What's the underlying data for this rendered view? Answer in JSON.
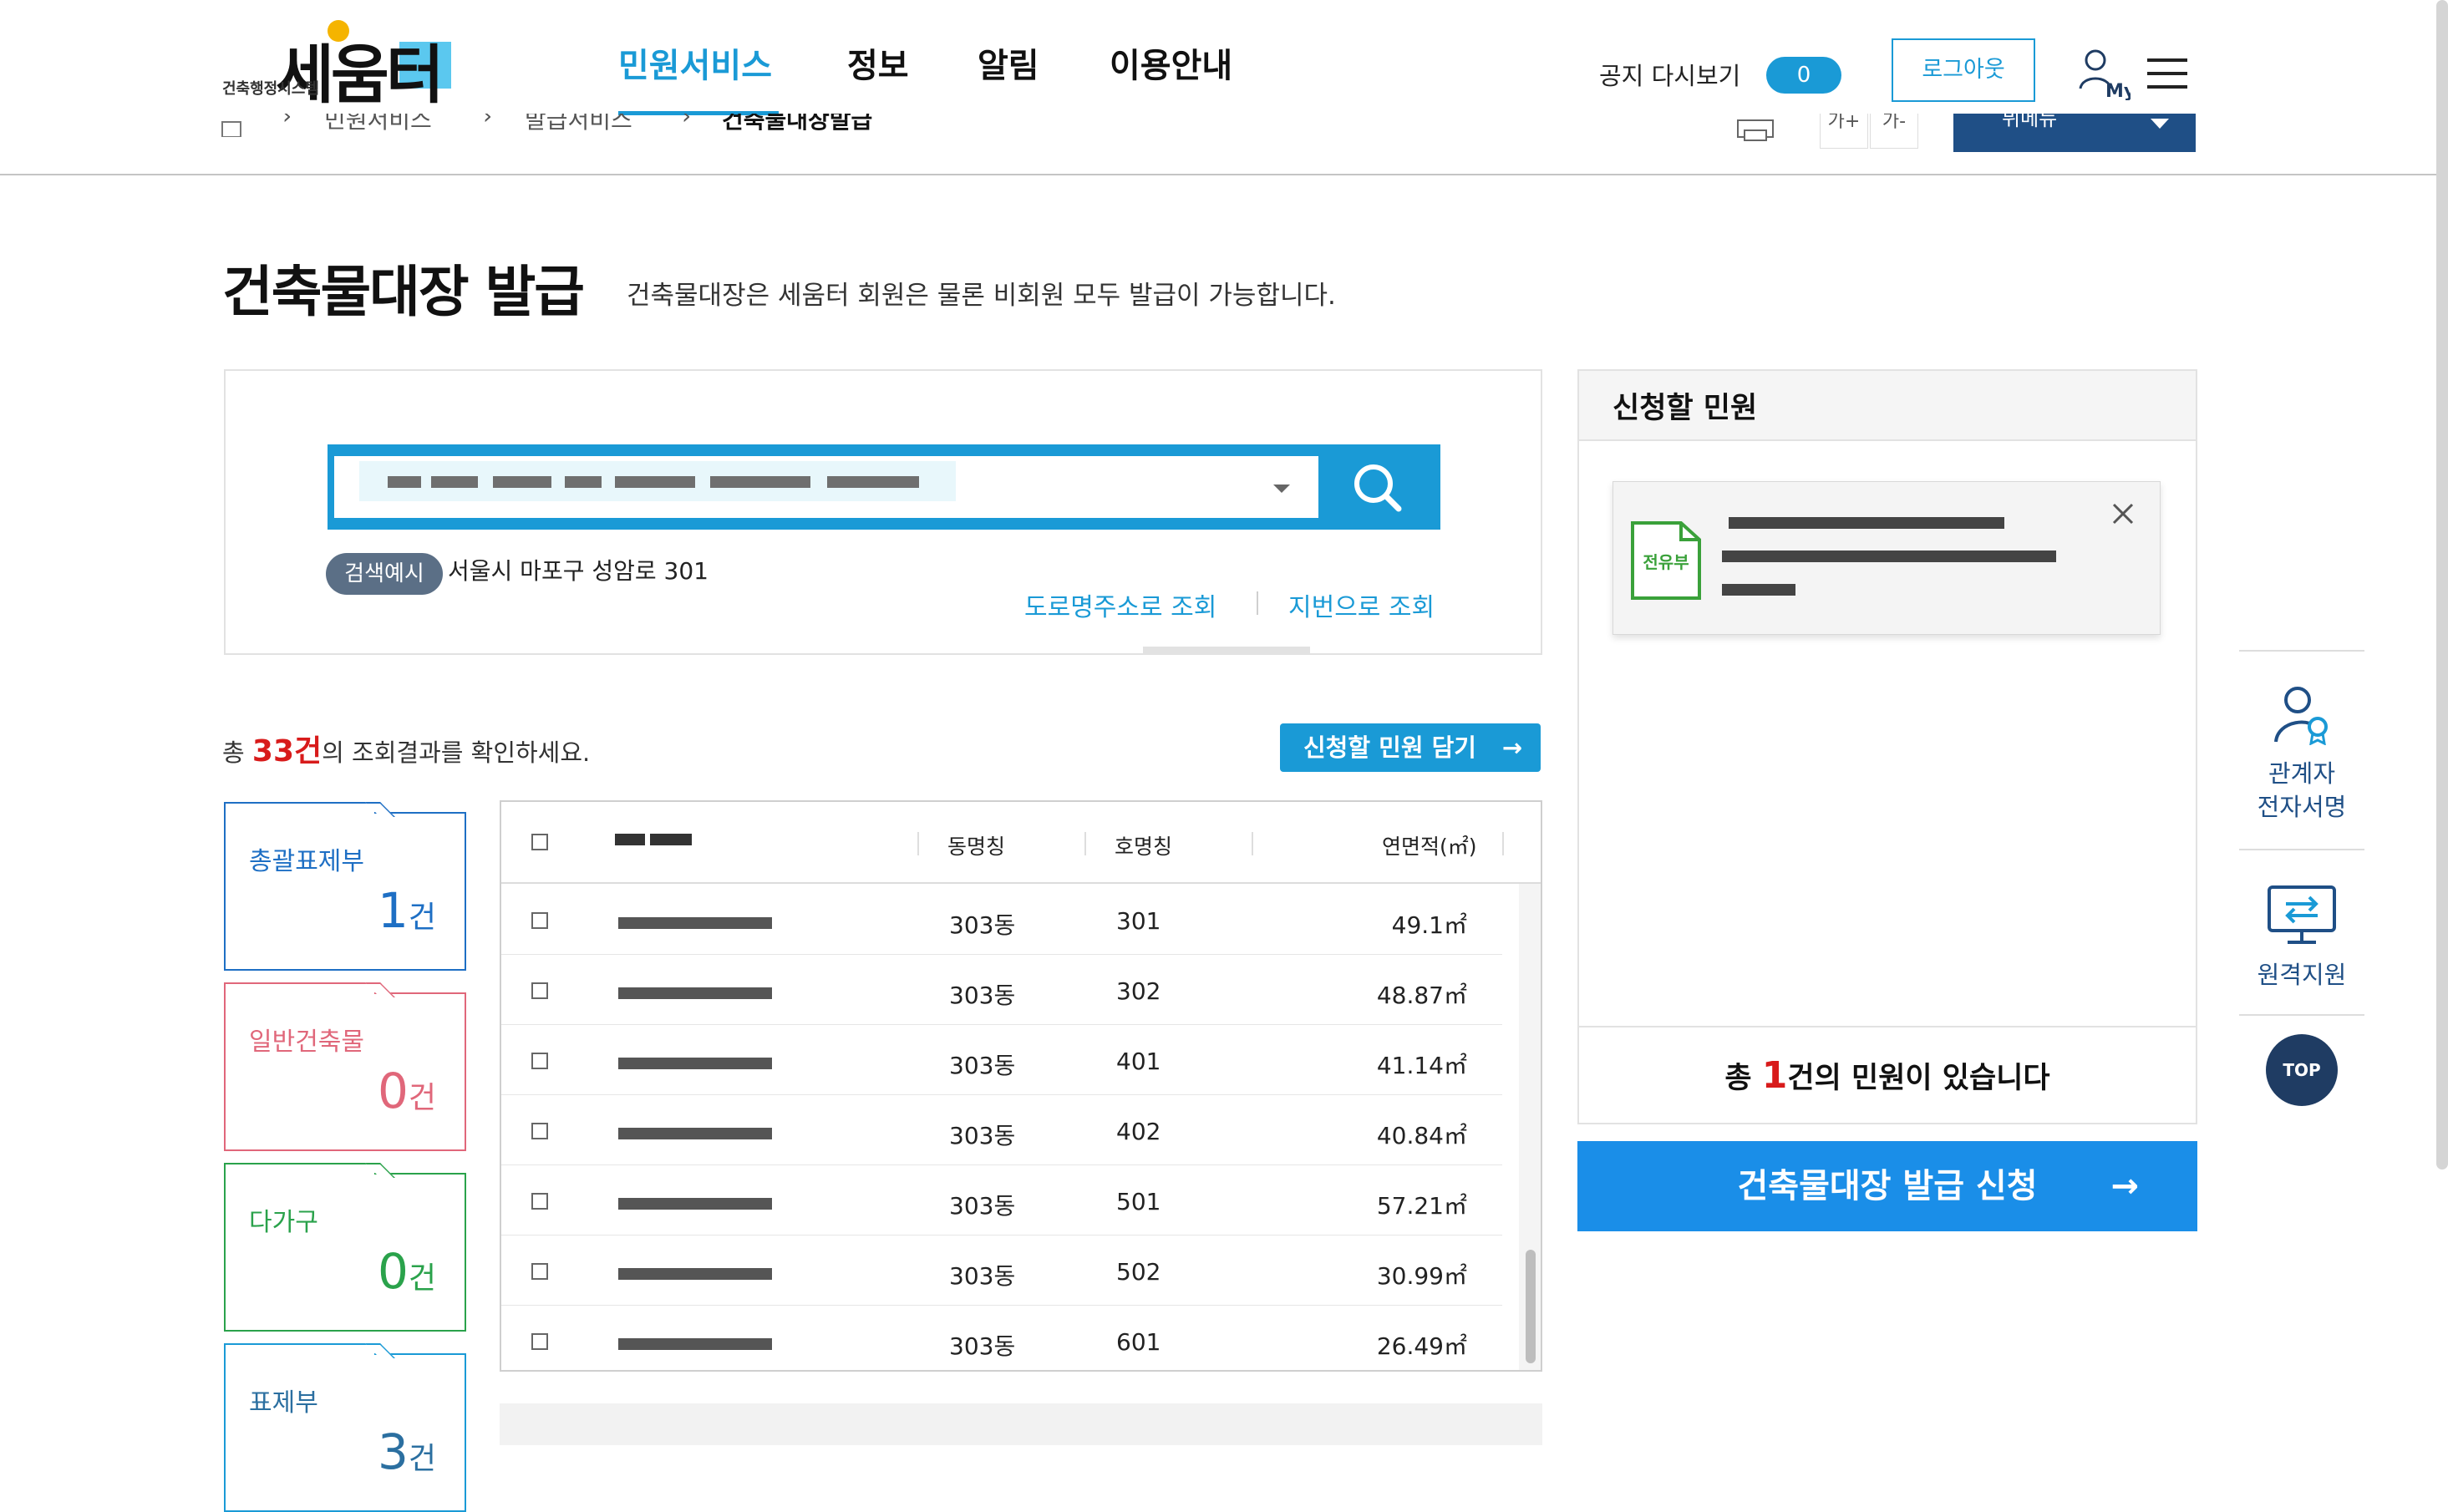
{
  "header": {
    "logo": {
      "text": "세움터",
      "sub": "건축행정시스템"
    },
    "nav": [
      "민원서비스",
      "정보",
      "알림",
      "이용안내"
    ],
    "notice_label": "공지 다시보기",
    "notice_count": "0",
    "logout_label": "로그아웃",
    "my_label": "My",
    "breadcrumb": [
      "민원서비스",
      "발급서비스",
      "건축물대장발급"
    ],
    "font_up": "가+",
    "font_down": "가-",
    "site_menu": "뷔메뉴"
  },
  "page": {
    "title": "건축물대장 발급",
    "description": "건축물대장은 세움터 회원은 물론 비회원 모두 발급이 가능합니다."
  },
  "search": {
    "example_badge": "검색예시",
    "example_text": "서울시 마포구 성암로 301",
    "road_label": "도로명주소로 조회",
    "jibun_label": "지번으로 조회"
  },
  "results": {
    "prefix": "총 ",
    "count": "33건",
    "suffix": "의 조회결과를 확인하세요.",
    "add_label": "신청할 민원 담기",
    "arrow": "→"
  },
  "categories": [
    {
      "label": "총괄표제부",
      "count": "1",
      "unit": "건"
    },
    {
      "label": "일반건축물",
      "count": "0",
      "unit": "건"
    },
    {
      "label": "다가구",
      "count": "0",
      "unit": "건"
    },
    {
      "label": "표제부",
      "count": "3",
      "unit": "건"
    }
  ],
  "table": {
    "columns": [
      "동명칭",
      "호명칭",
      "연면적(㎡)"
    ],
    "rows": [
      {
        "dong": "303동",
        "ho": "301",
        "area": "49.1㎡"
      },
      {
        "dong": "303동",
        "ho": "302",
        "area": "48.87㎡"
      },
      {
        "dong": "303동",
        "ho": "401",
        "area": "41.14㎡"
      },
      {
        "dong": "303동",
        "ho": "402",
        "area": "40.84㎡"
      },
      {
        "dong": "303동",
        "ho": "501",
        "area": "57.21㎡"
      },
      {
        "dong": "303동",
        "ho": "502",
        "area": "30.99㎡"
      },
      {
        "dong": "303동",
        "ho": "601",
        "area": "26.49㎡"
      }
    ]
  },
  "request": {
    "title": "신청할 민원",
    "item_tag": "전유부",
    "total_prefix": "총 ",
    "total_count": "1",
    "total_suffix": "건의 민원이 있습니다",
    "issue_label": "건축물대장 발급 신청",
    "arrow": "→"
  },
  "quick_menu": {
    "sign_line1": "관계자",
    "sign_line2": "전자서명",
    "remote_label": "원격지원",
    "top_label": "TOP"
  },
  "colors": {
    "accent": "#1a9ad6",
    "issue_button": "#1a8ee8",
    "navy": "#1f4f86",
    "count_red": "#d81b1b",
    "card_total": "#1e6fc4",
    "card_general": "#e0677a",
    "card_multi": "#2aa24b"
  }
}
